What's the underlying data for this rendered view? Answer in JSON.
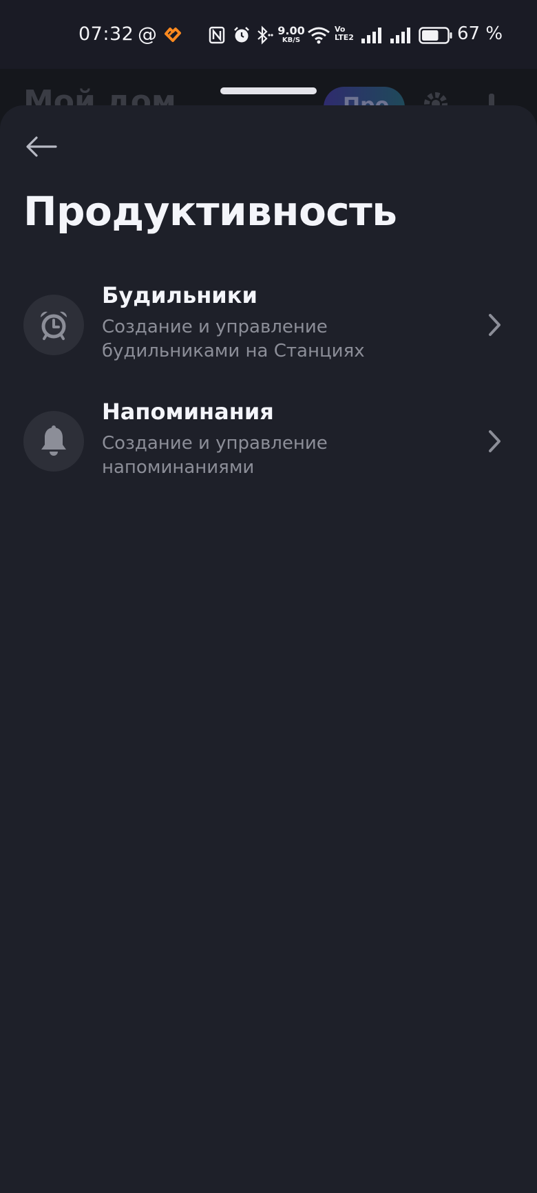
{
  "status_bar": {
    "time": "07:32",
    "at_symbol": "@",
    "speed_value": "9.00",
    "speed_unit": "KB/S",
    "volte_top": "Vo",
    "volte_bottom": "LTE2",
    "battery_percent": "67 %",
    "battery_level": 0.67,
    "icons": [
      "mail-at-icon",
      "app-notification-icon",
      "nfc-icon",
      "alarm-icon",
      "bluetooth-icon",
      "wifi-icon",
      "volte-icon",
      "signal-1-icon",
      "signal-2-icon",
      "battery-icon"
    ]
  },
  "background_page": {
    "title": "Мой дом",
    "pro_label": "Про"
  },
  "sheet": {
    "title": "Продуктивность",
    "items": [
      {
        "title": "Будильники",
        "description": "Создание и управление будильниками на Станциях",
        "icon": "alarm-clock-icon"
      },
      {
        "title": "Напоминания",
        "description": "Создание и управление напоминаниями",
        "icon": "bell-icon"
      }
    ]
  },
  "colors": {
    "sheet_background": "#1e2029",
    "icon_circle": "#2d2f38",
    "title_text": "#f4f5fa",
    "secondary_text": "#8c8e98",
    "accent_orange": "#ff8a1f"
  }
}
